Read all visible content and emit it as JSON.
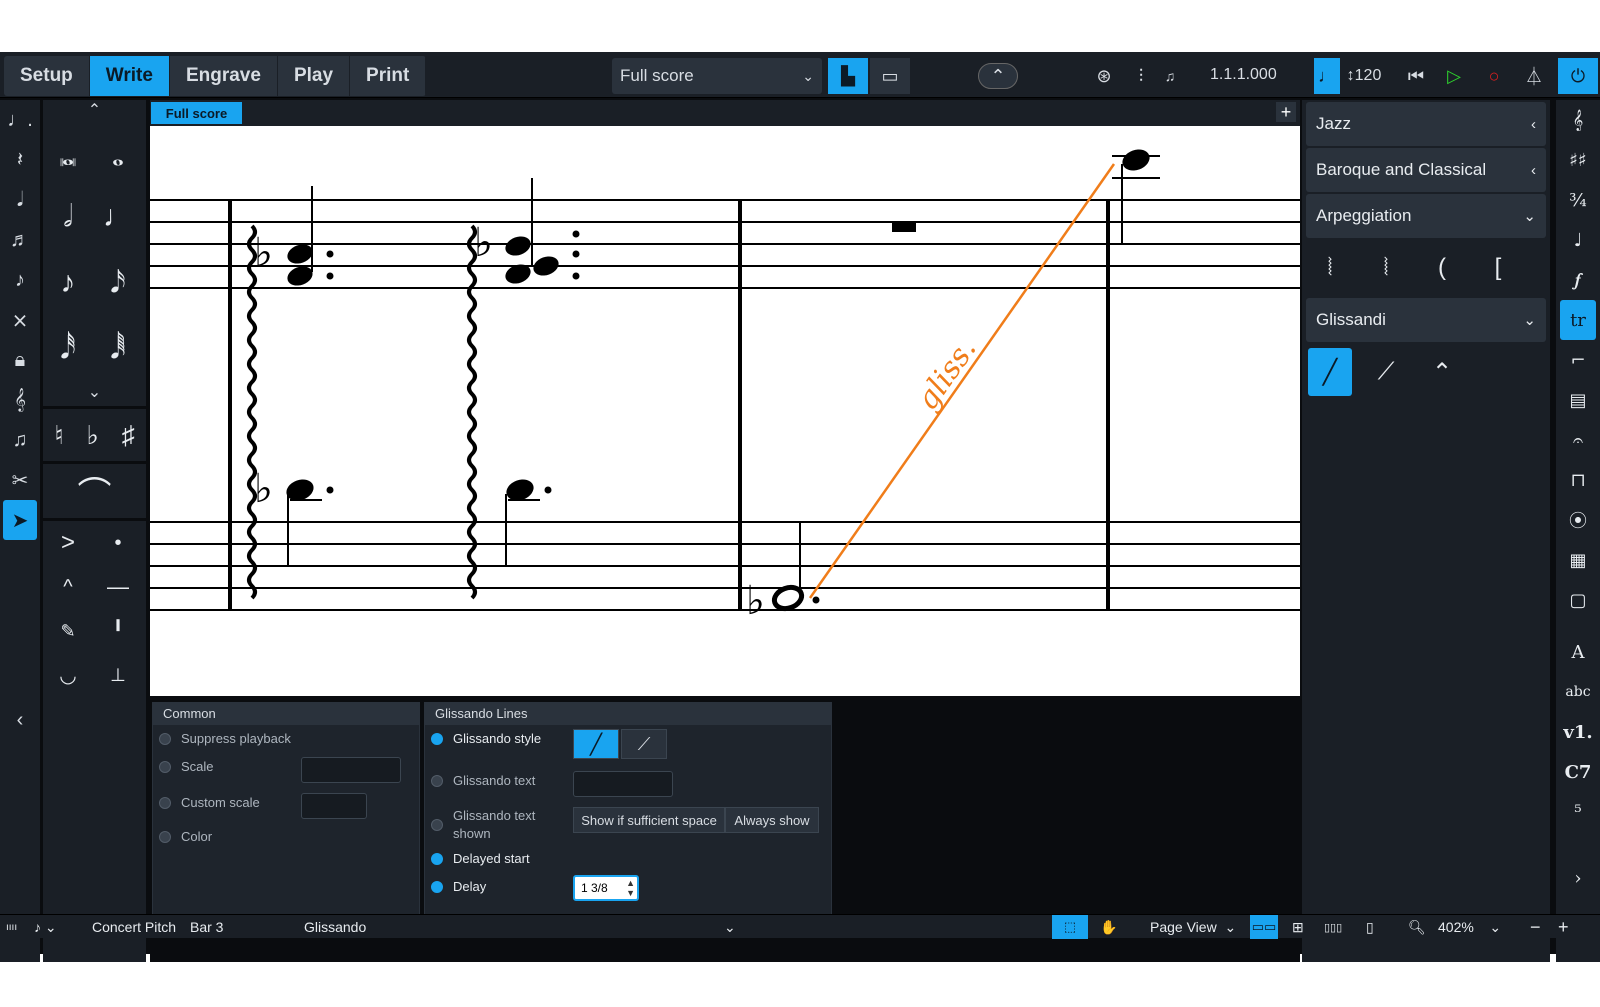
{
  "modes": [
    "Setup",
    "Write",
    "Engrave",
    "Play",
    "Print"
  ],
  "layout_select": "Full score",
  "position": "1.1.1.000",
  "tempo": "120",
  "score_tab": "Full score",
  "gliss_text": "gliss.",
  "panels": {
    "jazz": "Jazz",
    "baroque": "Baroque and Classical",
    "arpeggiation": "Arpeggiation",
    "glissandi": "Glissandi"
  },
  "props": {
    "common_title": "Common",
    "suppress_playback": "Suppress playback",
    "scale": "Scale",
    "custom_scale": "Custom scale",
    "color": "Color",
    "gliss_title": "Glissando Lines",
    "gliss_style": "Glissando style",
    "gliss_text": "Glissando text",
    "gliss_text_shown": "Glissando text shown",
    "show_if_space": "Show if sufficient space",
    "always_show": "Always show",
    "delayed_start": "Delayed start",
    "delay": "Delay",
    "delay_value": "1 3/8"
  },
  "status": {
    "concert_pitch": "Concert Pitch",
    "bar": "Bar 3",
    "selection": "Glissando",
    "view": "Page View",
    "zoom": "402%"
  },
  "right_strip_text": {
    "abc": "abc",
    "v1": "v1.",
    "c7": "C7"
  },
  "colors": {
    "accent": "#19a4f0",
    "gliss": "#f07d1a"
  }
}
